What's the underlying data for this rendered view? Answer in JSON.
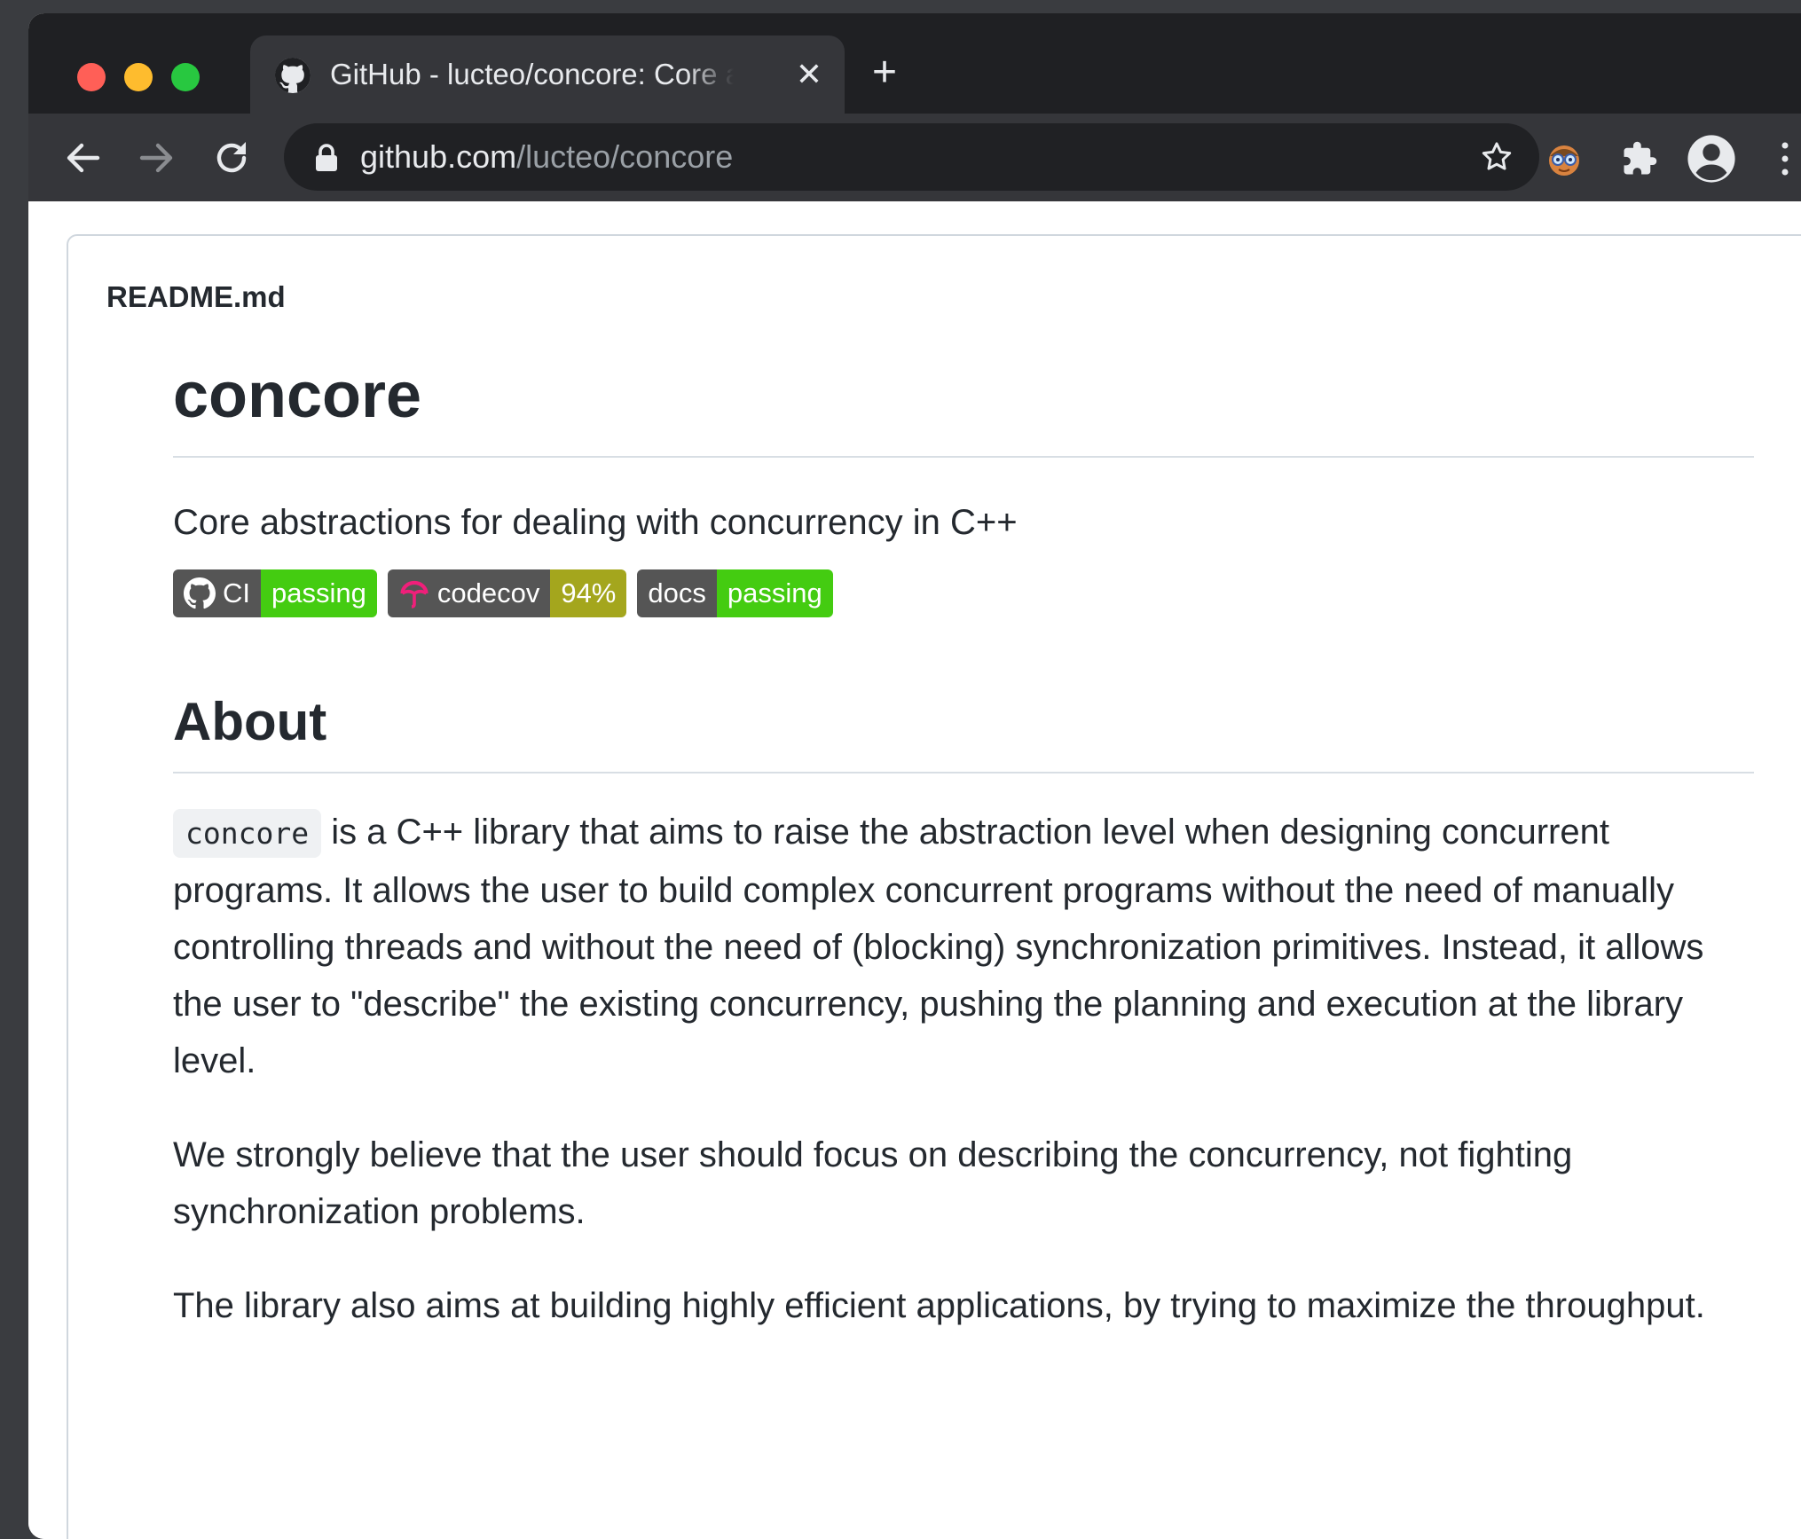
{
  "browser": {
    "tab": {
      "title": "GitHub - lucteo/concore: Core abstractions for dealing with concurrency in C++",
      "close_glyph": "✕"
    },
    "new_tab_glyph": "+",
    "address": {
      "host": "github.com",
      "path": "/lucteo/concore"
    },
    "icons": [
      "github-favicon-icon",
      "back-arrow-icon",
      "forward-arrow-icon",
      "reload-icon",
      "lock-icon",
      "star-icon",
      "extension-avatar-icon",
      "puzzle-icon",
      "profile-icon",
      "more-menu-icon"
    ]
  },
  "readme": {
    "filename": "README.md",
    "title": "concore",
    "description": "Core abstractions for dealing with concurrency in C++",
    "badges": [
      {
        "label": "CI",
        "value": "passing",
        "value_color": "#4c1"
      },
      {
        "label": "codecov",
        "value": "94%",
        "value_color": "#a4a61d"
      },
      {
        "label": "docs",
        "value": "passing",
        "value_color": "#4c1"
      }
    ],
    "about_heading": "About",
    "about_code": "concore",
    "about_p1": " is a C++ library that aims to raise the abstraction level when designing concurrent programs. It allows the user to build complex concurrent programs without the need of manually controlling threads and without the need of (blocking) synchronization primitives. Instead, it allows the user to \"describe\" the existing concurrency, pushing the planning and execution at the library level.",
    "about_p2": "We strongly believe that the user should focus on describing the concurrency, not fighting synchronization problems.",
    "about_p3": "The library also aims at building highly efficient applications, by trying to maximize the throughput."
  }
}
